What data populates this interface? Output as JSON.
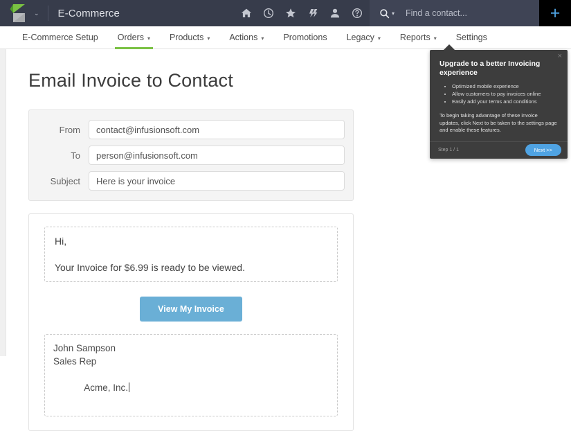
{
  "header": {
    "app_title": "E-Commerce",
    "logo_caret": "⌄",
    "icons": [
      {
        "name": "home-icon",
        "label": "Home"
      },
      {
        "name": "clock-icon",
        "label": "Recent"
      },
      {
        "name": "star-icon",
        "label": "Favorites"
      },
      {
        "name": "flash-icon",
        "label": "Quick actions"
      },
      {
        "name": "person-icon",
        "label": "My profile"
      },
      {
        "name": "help-icon",
        "label": "Help"
      }
    ],
    "search": {
      "placeholder": "Find a contact...",
      "value": "",
      "caret": "▾"
    },
    "add_button_label": "+",
    "colors": {
      "bar_background": "#373c4b",
      "search_background": "#3f4455",
      "add_background": "#000000",
      "add_plus": "#4fa3e3",
      "logo_green": "#7ac143",
      "logo_gray": "#a6a8ab"
    }
  },
  "nav": {
    "items": [
      {
        "label": "E-Commerce Setup",
        "has_caret": false,
        "active": false
      },
      {
        "label": "Orders",
        "has_caret": true,
        "active": true
      },
      {
        "label": "Products",
        "has_caret": true,
        "active": false
      },
      {
        "label": "Actions",
        "has_caret": true,
        "active": false
      },
      {
        "label": "Promotions",
        "has_caret": false,
        "active": false
      },
      {
        "label": "Legacy",
        "has_caret": true,
        "active": false
      },
      {
        "label": "Reports",
        "has_caret": true,
        "active": false
      },
      {
        "label": "Settings",
        "has_caret": false,
        "active": false
      }
    ],
    "caret_glyph": "▾",
    "active_underline_color": "#7ac143"
  },
  "page": {
    "title": "Email Invoice to Contact"
  },
  "form": {
    "fields": [
      {
        "label": "From",
        "value": "contact@infusionsoft.com",
        "placeholder": ""
      },
      {
        "label": "To",
        "value": "person@infusionsoft.com",
        "placeholder": ""
      },
      {
        "label": "Subject",
        "value": "Here is your invoice",
        "placeholder": ""
      }
    ]
  },
  "email_preview": {
    "greeting": "Hi,",
    "body_line": "Your Invoice for $6.99 is ready to be viewed.",
    "cta_label": "View My Invoice",
    "cta_color": "#6aafd6",
    "signature": {
      "line1": "John Sampson",
      "line2": "Sales Rep",
      "line3": "Acme, Inc."
    }
  },
  "coachmark": {
    "title": "Upgrade to a better Invoicing experience",
    "bullets": [
      "Optimized mobile experience",
      "Allow customers to pay invoices online",
      "Easily add your terms and conditions"
    ],
    "body": "To begin taking advantage of these invoice updates, click Next to be taken to the settings page and enable these features.",
    "step_label": "Step 1 / 1",
    "next_label": "Next >>",
    "close_label": "×",
    "accent_color": "#4fa3e3"
  }
}
